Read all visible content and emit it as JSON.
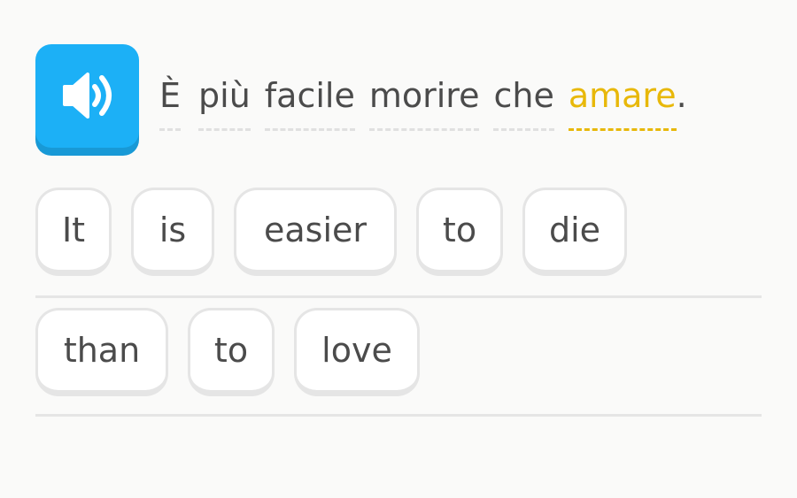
{
  "speaker": {
    "icon": "speaker-icon",
    "color": "#1cb0f6"
  },
  "prompt": {
    "words": [
      "È",
      "più",
      "facile",
      "morire",
      "che",
      "amare"
    ],
    "punctuation": ".",
    "highlight_color": "#e8b80a"
  },
  "word_bank": {
    "row1": [
      "It",
      "is",
      "easier",
      "to",
      "die"
    ],
    "row2": [
      "than",
      "to",
      "love"
    ]
  }
}
